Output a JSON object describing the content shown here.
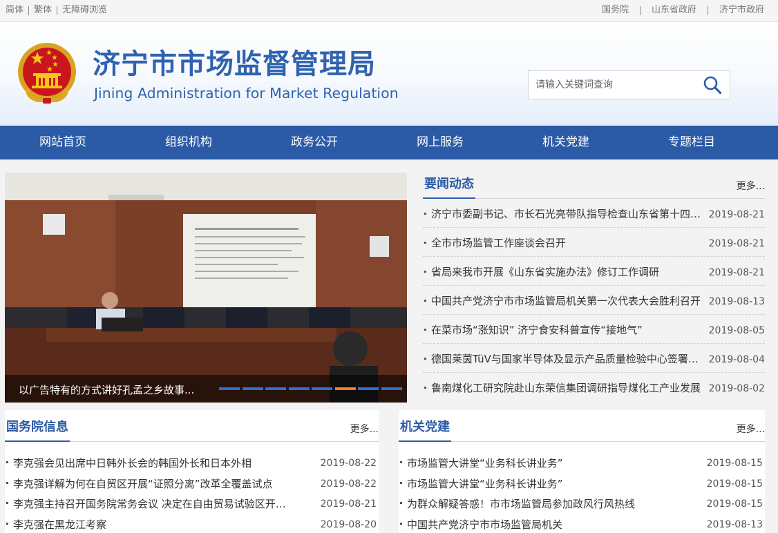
{
  "topbar": {
    "left_links": [
      "简体",
      "繁体",
      "无障碍浏览"
    ],
    "right_links": [
      "国务院",
      "山东省政府",
      "济宁市政府"
    ]
  },
  "header": {
    "emblem_icon": "national-emblem-icon",
    "title_cn": "济宁市市场监督管理局",
    "title_en": "Jining Administration for Market Regulation",
    "brand_color": "#2f63b0"
  },
  "search": {
    "placeholder": "请输入关键词查询",
    "icon": "search-icon"
  },
  "nav": {
    "items": [
      "网站首页",
      "组织机构",
      "政务公开",
      "网上服务",
      "机关党建",
      "专题栏目"
    ],
    "bg_color": "#2b5ba6"
  },
  "slider": {
    "caption": "以广告特有的方式讲好孔孟之乡故事...",
    "slide_count": 8,
    "active_slide": 5
  },
  "news": {
    "title": "要闻动态",
    "more": "更多...",
    "items": [
      {
        "title": "济宁市委副书记、市长石光亮带队指导检查山东省第十四届运动会",
        "date": "2019-08-21"
      },
      {
        "title": "全市市场监管工作座谈会召开",
        "date": "2019-08-21"
      },
      {
        "title": "省局来我市开展《山东省实施办法》修订工作调研",
        "date": "2019-08-21"
      },
      {
        "title": "中国共产党济宁市市场监管局机关第一次代表大会胜利召开",
        "date": "2019-08-13"
      },
      {
        "title": "在菜市场“涨知识” 济宁食安科普宣传“接地气”",
        "date": "2019-08-05"
      },
      {
        "title": "德国莱茵TüV与国家半导体及显示产品质量检验中心签署合作协议",
        "date": "2019-08-04"
      },
      {
        "title": "鲁南煤化工研究院赴山东荣信集团调研指导煤化工产业发展",
        "date": "2019-08-02"
      }
    ]
  },
  "state_council": {
    "title": "国务院信息",
    "more": "更多...",
    "items": [
      {
        "title": "李克强会见出席中日韩外长会的韩国外长和日本外相",
        "date": "2019-08-22"
      },
      {
        "title": "李克强详解为何在自贸区开展“证照分离”改革全覆盖试点",
        "date": "2019-08-22"
      },
      {
        "title": "李克强主持召开国务院常务会议 决定在自由贸易试验区开展“证照分离”改革",
        "date": "2019-08-21"
      },
      {
        "title": "李克强在黑龙江考察",
        "date": "2019-08-20"
      }
    ]
  },
  "party": {
    "title": "机关党建",
    "more": "更多...",
    "items": [
      {
        "title": "市场监管大讲堂“业务科长讲业务”",
        "date": "2019-08-15"
      },
      {
        "title": "市场监管大讲堂“业务科长讲业务”",
        "date": "2019-08-15"
      },
      {
        "title": "为群众解疑答惑！市市场监管局参加政风行风热线",
        "date": "2019-08-15"
      },
      {
        "title": "中国共产党济宁市市场监管局机关",
        "date": "2019-08-13"
      }
    ]
  }
}
